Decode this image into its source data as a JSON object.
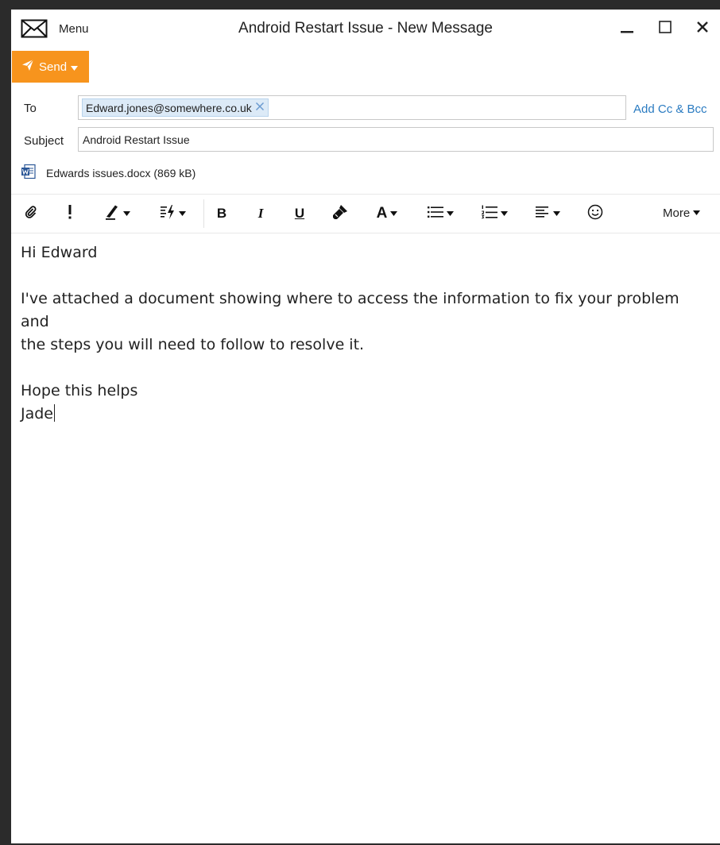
{
  "titlebar": {
    "menu_label": "Menu",
    "title": "Android Restart Issue - New Message",
    "icons": [
      "mail-envelope-icon",
      "minimize-icon",
      "maximize-icon",
      "close-icon"
    ]
  },
  "send": {
    "label": "Send",
    "color": "#f7941d"
  },
  "fields": {
    "to_label": "To",
    "recipient": "Edward.jones@somewhere.co.uk",
    "add_cc_bcc": "Add Cc & Bcc",
    "subject_label": "Subject",
    "subject_value": "Android Restart Issue"
  },
  "attachment": {
    "name": "Edwards issues.docx (869 kB)",
    "icon": "word-document-icon"
  },
  "toolbar": {
    "bold": "B",
    "italic": "I",
    "underline": "U",
    "font_color": "A",
    "more": "More",
    "icons": [
      "attach-icon",
      "importance-icon",
      "highlight-icon",
      "styles-icon",
      "format-painter-icon",
      "bullet-list-icon",
      "numbered-list-icon",
      "align-icon",
      "emoji-icon"
    ]
  },
  "body": {
    "greeting": "Hi Edward",
    "paragraph_line1": "I've attached a document showing where to access the information to fix your problem and",
    "paragraph_line2": "the steps you will need to follow to resolve it.",
    "closing": "Hope this helps",
    "signature": "Jade"
  },
  "colors": {
    "accent_send": "#f7941d",
    "link_blue": "#2a7bc1",
    "chip_bg": "#dceaf7"
  }
}
